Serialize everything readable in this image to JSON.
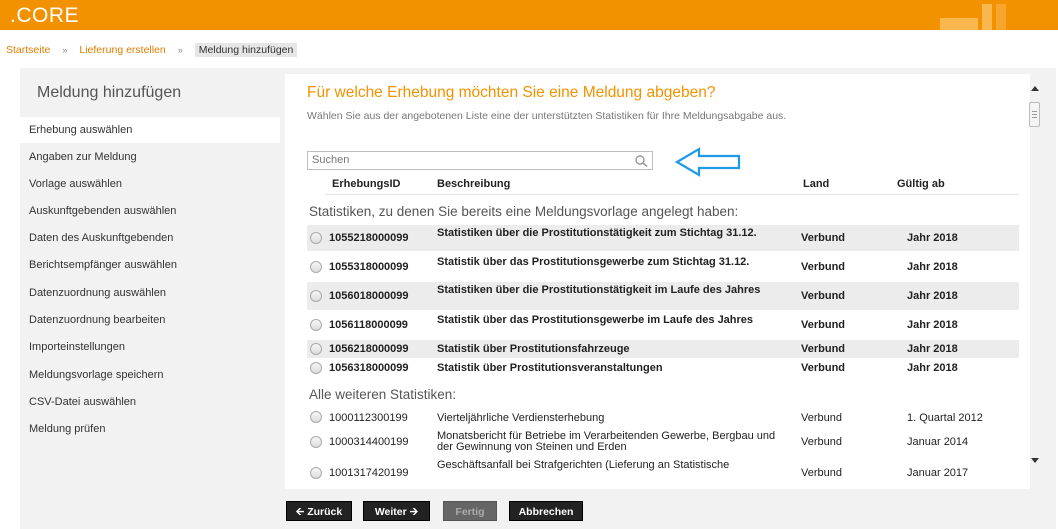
{
  "app": {
    "brand": ".CORE"
  },
  "breadcrumb": {
    "items": [
      "Startseite",
      "Lieferung erstellen"
    ],
    "separator": "»",
    "current": "Meldung hinzufügen"
  },
  "sidebar": {
    "title": "Meldung hinzufügen",
    "items": [
      "Erhebung auswählen",
      "Angaben zur Meldung",
      "Vorlage auswählen",
      "Auskunftgebenden auswählen",
      "Daten des Auskunftgebenden",
      "Berichtsempfänger auswählen",
      "Datenzuordnung auswählen",
      "Datenzuordnung bearbeiten",
      "Importeinstellungen",
      "Meldungsvorlage speichern",
      "CSV-Datei auswählen",
      "Meldung prüfen"
    ],
    "active_index": 0
  },
  "main": {
    "question": "Für welche Erhebung möchten Sie eine Meldung abgeben?",
    "instruction": "Wählen Sie aus der angebotenen Liste eine der unterstützten Statistiken für Ihre Meldungsabgabe aus.",
    "search_placeholder": "Suchen",
    "columns": [
      "ErhebungsID",
      "Beschreibung",
      "Land",
      "Gültig ab"
    ],
    "section_existing": "Statistiken, zu denen Sie bereits eine Meldungsvorlage angelegt haben:",
    "section_other": "Alle weiteren Statistiken:",
    "existing_rows": [
      {
        "id": "1055218000099",
        "desc": "Statistiken über die Prostitutionstätigkeit zum Stichtag 31.12.",
        "land": "Verbund",
        "valid": "Jahr 2018"
      },
      {
        "id": "1055318000099",
        "desc": "Statistik über das Prostitutionsgewerbe zum Stichtag 31.12.",
        "land": "Verbund",
        "valid": "Jahr 2018"
      },
      {
        "id": "1056018000099",
        "desc": "Statistiken über die Prostitutionstätigkeit im Laufe des Jahres",
        "land": "Verbund",
        "valid": "Jahr 2018"
      },
      {
        "id": "1056118000099",
        "desc": "Statistik über das Prostitutionsgewerbe im Laufe des Jahres",
        "land": "Verbund",
        "valid": "Jahr 2018"
      },
      {
        "id": "1056218000099",
        "desc": "Statistik über Prostitutionsfahrzeuge",
        "land": "Verbund",
        "valid": "Jahr 2018"
      },
      {
        "id": "1056318000099",
        "desc": "Statistik über Prostitutionsveranstaltungen",
        "land": "Verbund",
        "valid": "Jahr 2018"
      }
    ],
    "other_rows": [
      {
        "id": "1000112300199",
        "desc": "Vierteljährliche Verdiensterhebung",
        "land": "Verbund",
        "valid": "1. Quartal 2012"
      },
      {
        "id": "1000314400199",
        "desc": "Monatsbericht für Betriebe im Verarbeitenden Gewerbe, Bergbau und der Gewinnung von Steinen und Erden",
        "land": "Verbund",
        "valid": "Januar 2014"
      },
      {
        "id": "1001317420199",
        "desc": "Geschäftsanfall bei Strafgerichten (Lieferung an Statistische",
        "land": "Verbund",
        "valid": "Januar 2017"
      }
    ]
  },
  "buttons": {
    "back": "Zurück",
    "next": "Weiter",
    "finish": "Fertig",
    "cancel": "Abbrechen"
  },
  "colors": {
    "accent": "#f39200",
    "annotation": "#1e9be6"
  },
  "icons": {
    "search": "search-icon",
    "annotation": "left-arrow-icon"
  }
}
